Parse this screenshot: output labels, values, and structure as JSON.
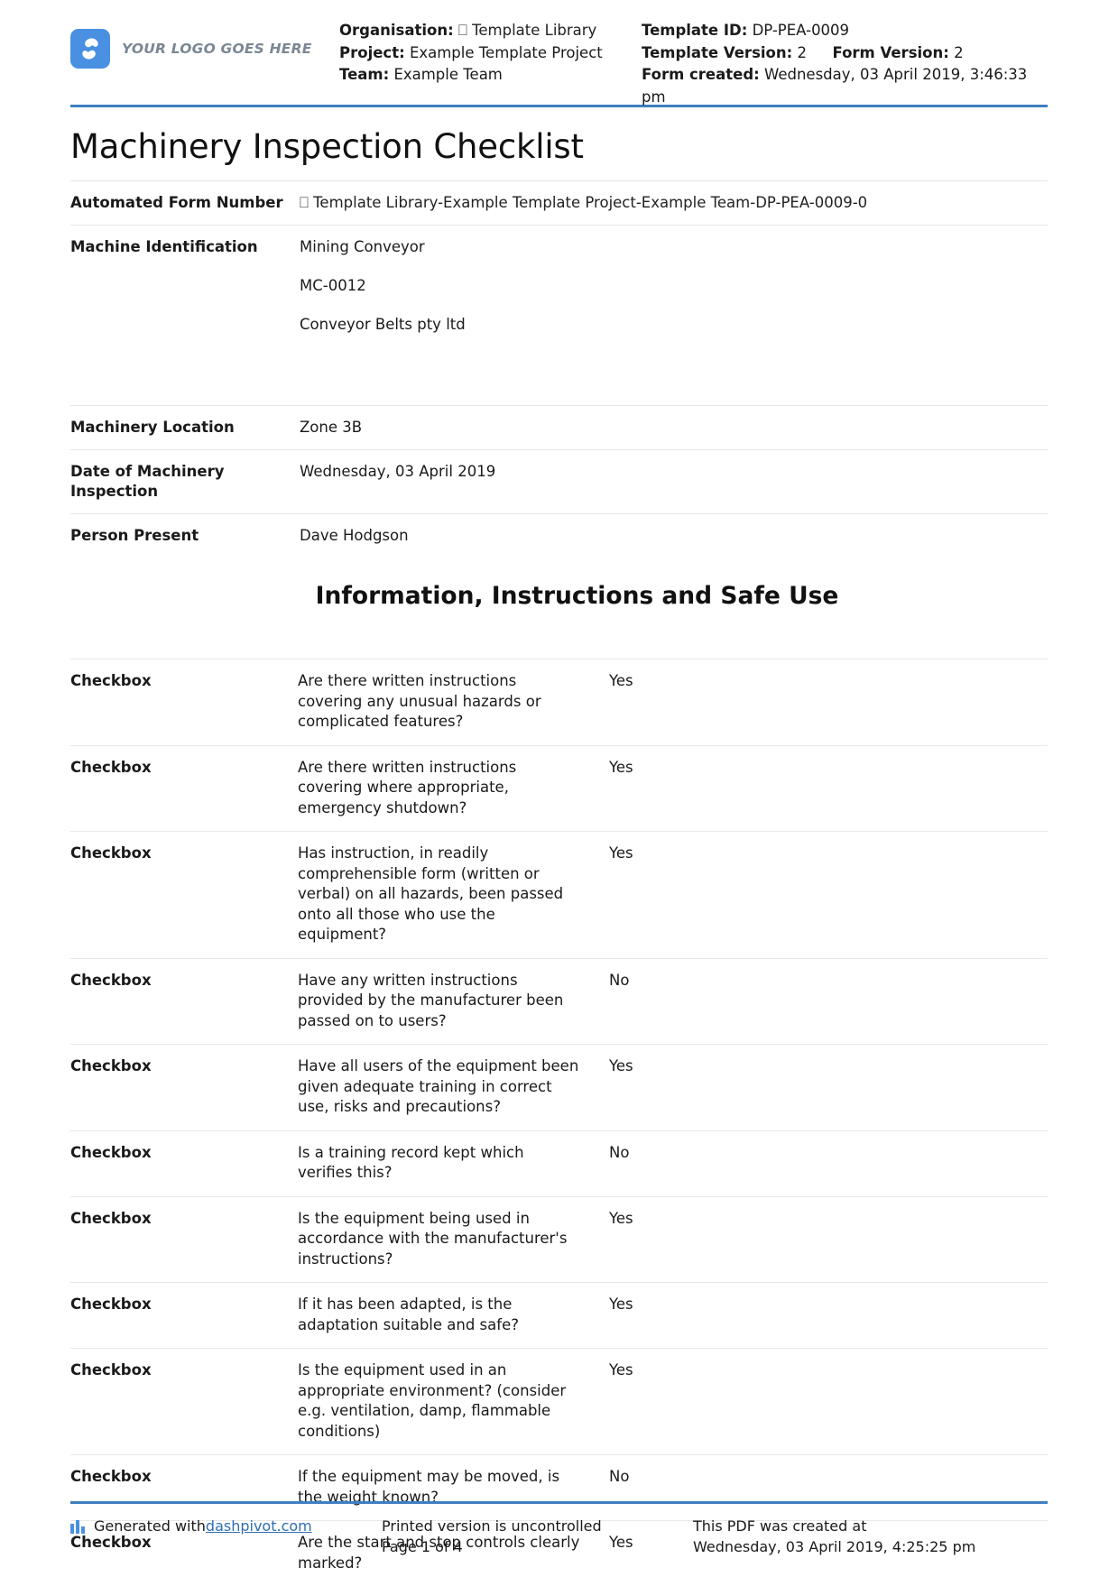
{
  "header": {
    "logo_text": "YOUR LOGO GOES HERE",
    "organisation_label": "Organisation:",
    "organisation_value": "⎕ Template Library",
    "project_label": "Project:",
    "project_value": "Example Template Project",
    "team_label": "Team:",
    "team_value": "Example Team",
    "template_id_label": "Template ID:",
    "template_id_value": "DP-PEA-0009",
    "template_version_label": "Template Version:",
    "template_version_value": "2",
    "form_version_label": "Form Version:",
    "form_version_value": "2",
    "form_created_label": "Form created:",
    "form_created_value": "Wednesday, 03 April 2019, 3:46:33 pm"
  },
  "title": "Machinery Inspection Checklist",
  "fields": [
    {
      "label": "Automated Form Number",
      "values": [
        "⎕ Template Library-Example Template Project-Example Team-DP-PEA-0009-0"
      ]
    },
    {
      "label": "Machine Identification",
      "values": [
        "Mining Conveyor",
        "MC-0012",
        "Conveyor Belts pty ltd"
      ]
    },
    {
      "label": "Machinery Location",
      "values": [
        "Zone 3B"
      ]
    },
    {
      "label": "Date of Machinery Inspection",
      "values": [
        "Wednesday, 03 April 2019"
      ]
    },
    {
      "label": "Person Present",
      "values": [
        "Dave Hodgson"
      ]
    }
  ],
  "section_heading": "Information, Instructions and Safe Use",
  "checklist": [
    {
      "type": "Checkbox",
      "question": "Are there written instructions covering any unusual hazards or complicated features?",
      "answer": "Yes"
    },
    {
      "type": "Checkbox",
      "question": "Are there written instructions covering where appropriate, emergency shutdown?",
      "answer": "Yes"
    },
    {
      "type": "Checkbox",
      "question": "Has instruction, in readily comprehensible form (written or verbal) on all hazards, been passed onto all those who use the equipment?",
      "answer": "Yes"
    },
    {
      "type": "Checkbox",
      "question": "Have any written instructions provided by the manufacturer been passed on to users?",
      "answer": "No"
    },
    {
      "type": "Checkbox",
      "question": "Have all users of the equipment been given adequate training in correct use, risks and precautions?",
      "answer": "Yes"
    },
    {
      "type": "Checkbox",
      "question": "Is a training record kept which verifies this?",
      "answer": "No"
    },
    {
      "type": "Checkbox",
      "question": "Is the equipment being used in accordance with the manufacturer's instructions?",
      "answer": "Yes"
    },
    {
      "type": "Checkbox",
      "question": "If it has been adapted, is the adaptation suitable and safe?",
      "answer": "Yes"
    },
    {
      "type": "Checkbox",
      "question": "Is the equipment used in an appropriate environment? (consider e.g. ventilation, damp, flammable conditions)",
      "answer": "Yes"
    },
    {
      "type": "Checkbox",
      "question": "If the equipment may be moved, is the weight known?",
      "answer": "No"
    },
    {
      "type": "Checkbox",
      "question": "Are the start and stop controls clearly marked?",
      "answer": "Yes"
    }
  ],
  "footer": {
    "generated_prefix": "Generated with ",
    "generated_link": "dashpivot.com",
    "printed_line1": "Printed version is uncontrolled",
    "printed_line2": "Page 1 of 4",
    "created_line1": "This PDF was created at",
    "created_line2": "Wednesday, 03 April 2019, 4:25:25 pm"
  },
  "colors": {
    "accent": "#3f7fc1",
    "logo": "#4a90e2",
    "link": "#2f6fb5"
  }
}
